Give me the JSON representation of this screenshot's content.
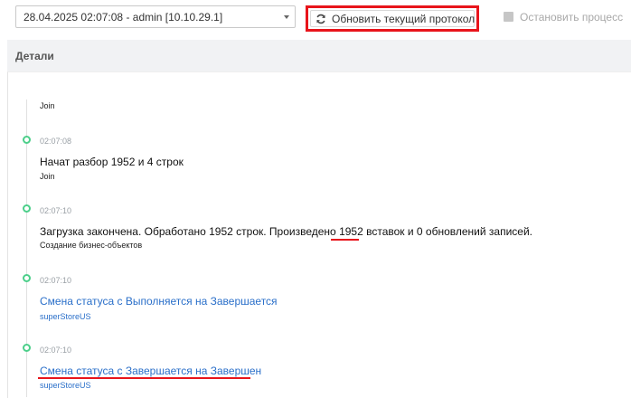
{
  "toolbar": {
    "protocol_value": "28.04.2025 02:07:08 - admin [10.10.29.1]",
    "refresh_label": "Обновить текущий протокол",
    "stop_label": "Остановить процесс"
  },
  "details": {
    "title": "Детали"
  },
  "log": {
    "first_source": "Join",
    "entries": [
      {
        "time": "02:07:08",
        "message": "Начат разбор 1952 и 4 строк",
        "source": "Join"
      },
      {
        "time": "02:07:10",
        "message_before": "Загрузка закончена. Обработано 1952 строк. Произведено ",
        "message_highlight": "1952",
        "message_after": " вставок и 0 обновлений записей.",
        "source": "Создание бизнес-объектов"
      },
      {
        "time": "02:07:10",
        "message": "Смена статуса с Выполняется на Завершается",
        "source": "superStoreUS"
      },
      {
        "time": "02:07:10",
        "message": "Смена статуса с Завершается на Завершен",
        "source": "superStoreUS"
      }
    ]
  },
  "colors": {
    "accent_red": "#e8141b",
    "timeline_green": "#4ccf8a",
    "link_blue": "#2a6fc9"
  }
}
